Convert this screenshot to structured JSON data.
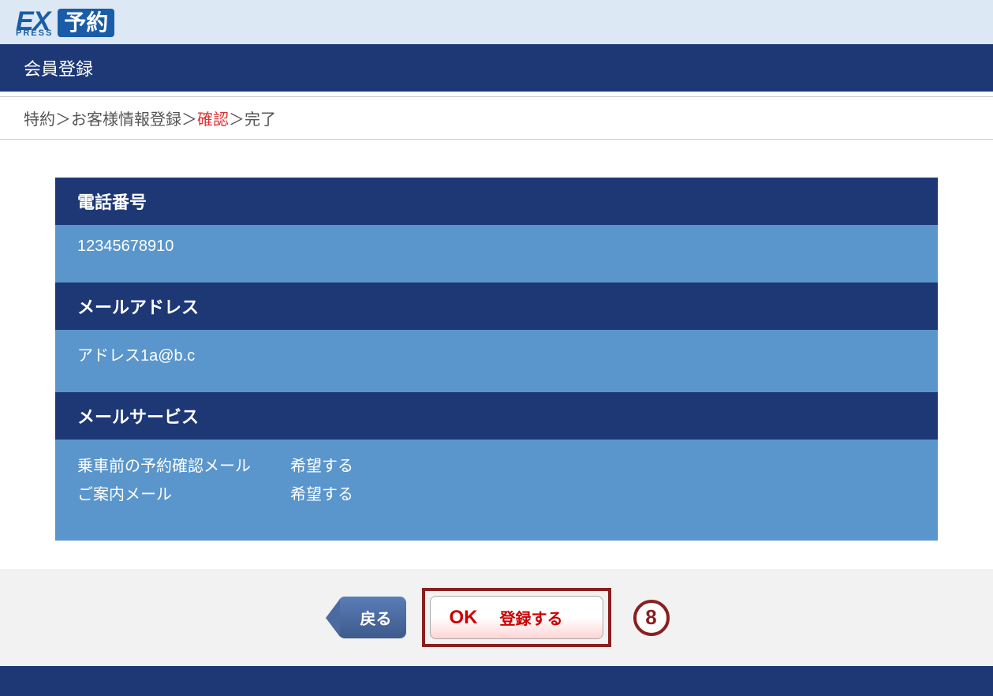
{
  "logo": {
    "ex": "EX",
    "press": "PRESS",
    "yoyaku": "予約"
  },
  "header": {
    "title": "会員登録"
  },
  "breadcrumb": {
    "step1": "特約",
    "step2": "お客様情報登録",
    "step3": "確認",
    "step4": "完了",
    "sep": "＞"
  },
  "sections": {
    "phone": {
      "heading": "電話番号",
      "value": "12345678910"
    },
    "email": {
      "heading": "メールアドレス",
      "value": "アドレス1a@b.c"
    },
    "mailService": {
      "heading": "メールサービス",
      "rows": [
        {
          "label": "乗車前の予約確認メール",
          "value": "希望する"
        },
        {
          "label": "ご案内メール",
          "value": "希望する"
        }
      ]
    }
  },
  "buttons": {
    "back": "戻る",
    "okText": "OK",
    "okLabel": "登録する"
  },
  "stepBadge": "8"
}
